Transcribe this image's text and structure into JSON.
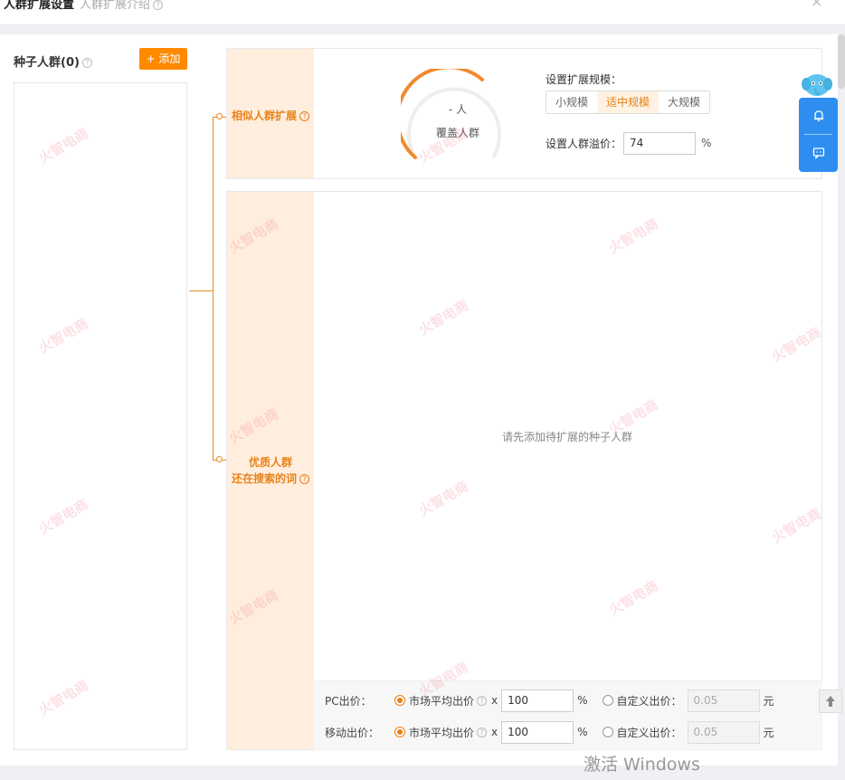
{
  "dialog": {
    "title": "人群扩展设置",
    "subtitle": "人群扩展介绍",
    "close": "×"
  },
  "seed": {
    "title": "种子人群(0)",
    "add_button": "+ 添加"
  },
  "similar_card": {
    "label": "相似人群扩展",
    "gauge_count": "- 人",
    "gauge_caption": "覆盖人群",
    "scale_title": "设置扩展规模：",
    "scale_options": [
      "小规模",
      "适中规模",
      "大规模"
    ],
    "scale_selected": "适中规模",
    "premium_label": "设置人群溢价：",
    "premium_value": "74",
    "premium_unit": "%"
  },
  "quality_card": {
    "label_line1": "优质人群",
    "label_line2": "还在搜索的词",
    "empty_message": "请先添加待扩展的种子人群",
    "pc_label": "PC出价：",
    "mobile_label": "移动出价：",
    "market_avg_label": "市场平均出价",
    "multiplier": "x",
    "pc_value": "100",
    "mobile_value": "100",
    "percent": "%",
    "custom_label": "自定义出价：",
    "custom_placeholder": "0.05",
    "yuan": "元"
  },
  "side_widget": {
    "bell_icon": "bell-icon",
    "chat_icon": "chat-icon"
  },
  "os_watermark": "激活 Windows",
  "brand_watermark": "火智电商",
  "colors": {
    "accent": "#ff8a00",
    "label_bg": "#ffeedd",
    "label_text": "#e8821a",
    "widget_blue": "#2e8ef0"
  }
}
